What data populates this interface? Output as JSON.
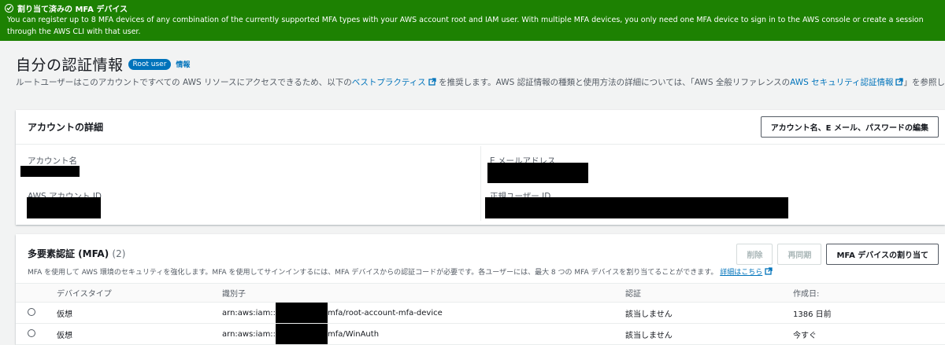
{
  "flash": {
    "title": "割り当て済みの MFA デバイス",
    "message": "You can register up to 8 MFA devices of any combination of the currently supported MFA types with your AWS account root and IAM user. With multiple MFA devices, you only need one MFA device to sign in to the AWS console or create a session through the AWS CLI with that user.",
    "color": "#1d8102"
  },
  "page": {
    "title": "自分の認証情報",
    "badge": "Root user",
    "info": "情報",
    "desc_prefix": "ルートユーザーはこのアカウントですべての AWS リソースにアクセスできるため、以下の",
    "desc_link1": "ベストプラクティス",
    "desc_mid": "を推奨します。AWS 認証情報の種類と使用方法の詳細については、「AWS 全般リファレンスの",
    "desc_link2": "AWS セキュリティ認証情報",
    "desc_suffix": "」を参照してください"
  },
  "account": {
    "title": "アカウントの詳細",
    "edit_button": "アカウント名、E メール、パスワードの編集",
    "labels": {
      "name": "アカウント名",
      "email": "E メールアドレス",
      "account_id": "AWS アカウント ID",
      "canonical_id": "正規ユーザー ID"
    }
  },
  "mfa": {
    "title": "多要素認証 (MFA)",
    "count": "(2)",
    "desc": "MFA を使用して AWS 環境のセキュリティを強化します。MFA を使用してサインインするには、MFA デバイスからの認証コードが必要です。各ユーザーには、最大 8 つの MFA デバイスを割り当てることができます。",
    "desc_link": "詳細はこちら",
    "buttons": {
      "delete": "削除",
      "resync": "再同期",
      "assign": "MFA デバイスの割り当て"
    },
    "columns": [
      "デバイスタイプ",
      "識別子",
      "認証",
      "作成日:"
    ],
    "rows": [
      {
        "type": "仮想",
        "id_prefix": "arn:aws:iam::",
        "id_suffix": "mfa/root-account-mfa-device",
        "auth": "該当しません",
        "created": "1386 日前"
      },
      {
        "type": "仮想",
        "id_prefix": "arn:aws:iam::",
        "id_suffix": "mfa/WinAuth",
        "auth": "該当しません",
        "created": "今すぐ"
      }
    ]
  }
}
